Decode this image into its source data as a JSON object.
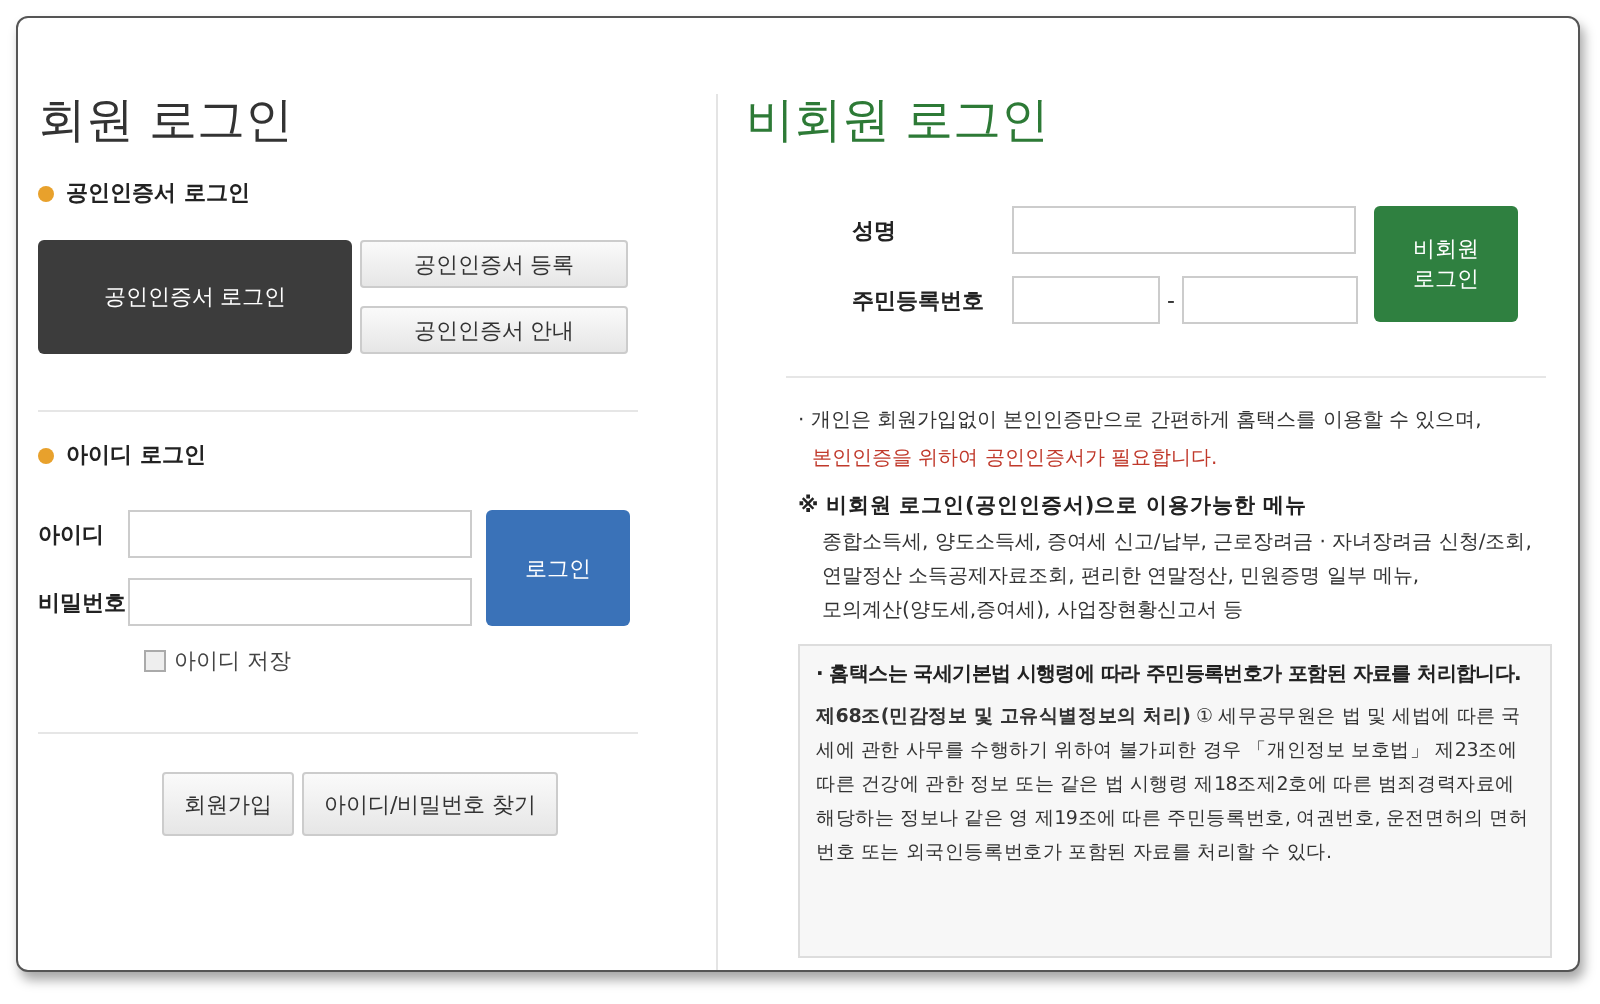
{
  "member_login": {
    "title": "회원 로그인",
    "cert_section": {
      "heading": "공인인증서 로그인",
      "login_button": "공인인증서 로그인",
      "buttons": [
        "공인인증서 등록",
        "공인인증서 안내"
      ]
    },
    "id_section": {
      "heading": "아이디 로그인",
      "fields": [
        {
          "label": "아이디"
        },
        {
          "label": "비밀번호"
        }
      ],
      "login_button": "로그인",
      "remember": {
        "label": "아이디 저장",
        "checked": false
      }
    },
    "bottom_buttons": [
      "회원가입",
      "아이디/비밀번호 찾기"
    ]
  },
  "guest_login": {
    "title": "비회원 로그인",
    "name_label": "성명",
    "rrn_label": "주민등록번호",
    "rrn_separator": "-",
    "login_button": "비회원 로그인",
    "notice": [
      {
        "kind": "normal",
        "text": "· 개인은 회원가입없이 본인인증만으로 간편하게 홈택스를 이용할 수 있으며,"
      },
      {
        "kind": "warning",
        "text": "본인인증을 위하여 공인인증서가 필요합니다."
      }
    ],
    "menu": {
      "heading": "※ 비회원 로그인(공인인증서)으로 이용가능한 메뉴",
      "lines": [
        "종합소득세, 양도소득세, 증여세 신고/납부, 근로장려금 · 자녀장려금 신청/조회,",
        "연말정산 소득공제자료조회, 편리한 연말정산, 민원증명 일부 메뉴,",
        "모의계산(양도세,증여세), 사업장현황신고서 등"
      ]
    },
    "legal_box": {
      "heading": "· 홈택스는 국세기본법 시행령에 따라 주민등록번호가 포함된 자료를 처리합니다.",
      "body": "**제68조(민감정보 및 고유식별정보의 처리)** ① 세무공무원은 법 및 세법에 따른 국세에 관한 사무를 수행하기 위하여 불가피한 경우 「개인정보 보호법」 제23조에 따른 건강에 관한 정보 또는 같은 법 시행령 제18조제2호에 따른 범죄경력자료에 해당하는 정보나 같은 영 제19조에 따른 주민등록번호, 여권번호, 운전면허의 면허번호 또는 외국인등록번호가 포함된 자료를 처리할 수 있다."
    }
  }
}
